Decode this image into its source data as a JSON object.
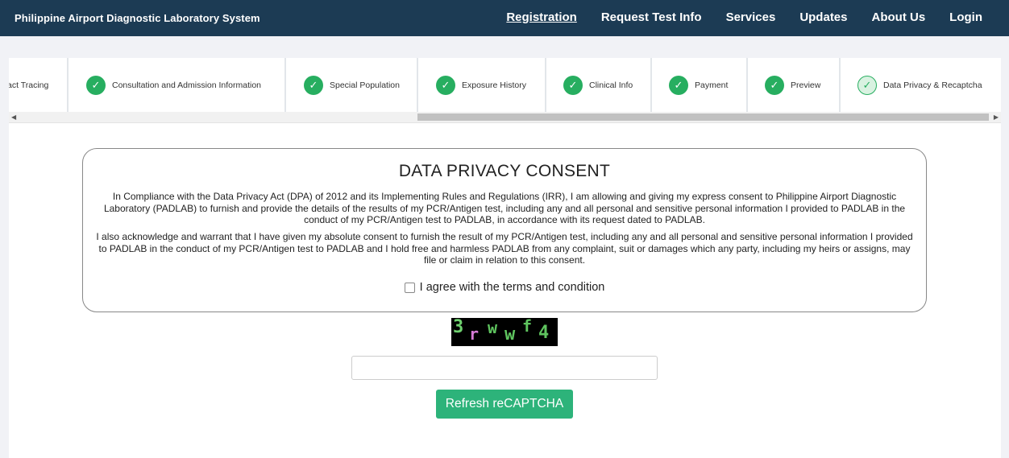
{
  "navbar": {
    "brand": "Philippine Airport Diagnostic Laboratory System",
    "links": [
      "Registration",
      "Request Test Info",
      "Services",
      "Updates",
      "About Us",
      "Login"
    ],
    "active": "Registration"
  },
  "stepper": {
    "steps": [
      {
        "label": "act Tracing",
        "status": "partial"
      },
      {
        "label": "Consultation and Admission Information",
        "status": "done"
      },
      {
        "label": "Special Population",
        "status": "done"
      },
      {
        "label": "Exposure History",
        "status": "done"
      },
      {
        "label": "Clinical Info",
        "status": "done"
      },
      {
        "label": "Payment",
        "status": "done"
      },
      {
        "label": "Preview",
        "status": "done"
      },
      {
        "label": "Data Privacy & Recaptcha",
        "status": "current"
      }
    ]
  },
  "consent": {
    "title": "DATA PRIVACY CONSENT",
    "paragraph1": "In Compliance with the Data Privacy Act (DPA) of 2012 and its Implementing Rules and Regulations (IRR), I am allowing and giving my express consent to Philippine Airport Diagnostic Laboratory (PADLAB) to furnish and provide the details of the results of my PCR/Antigen test, including any and all personal and sensitive personal information I provided to PADLAB in the conduct of my PCR/Antigen test to PADLAB, in accordance with its request dated to PADLAB.",
    "paragraph2": "I also acknowledge and warrant that I have given my absolute consent to furnish the result of my PCR/Antigen test, including any and all personal and sensitive personal information I provided to PADLAB in the conduct of my PCR/Antigen test to PADLAB and I hold free and harmless PADLAB from any complaint, suit or damages which any party, including my heirs or assigns, may file or claim in relation to this consent.",
    "agree_label": "I agree with the terms and condition"
  },
  "captcha": {
    "chars": [
      "3",
      "r",
      "w",
      "w",
      "f",
      "4"
    ],
    "colors": [
      "#6fd16f",
      "#d57ad5",
      "#5fc45f",
      "#5fc45f",
      "#5fc45f",
      "#5fc45f"
    ]
  },
  "captcha_input": {
    "value": "",
    "placeholder": ""
  },
  "refresh_button": {
    "label": "Refresh reCAPTCHA"
  },
  "colors": {
    "navbar": "#1c3b54",
    "accent": "#2db37a",
    "check": "#27ae60"
  }
}
